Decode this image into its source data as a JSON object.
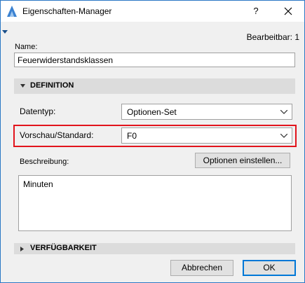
{
  "window": {
    "title": "Eigenschaften-Manager",
    "help_label": "?",
    "editable_text": "Bearbeitbar: 1"
  },
  "name": {
    "label": "Name:",
    "value": "Feuerwiderstandsklassen"
  },
  "definition": {
    "header": "DEFINITION",
    "datatype_label": "Datentyp:",
    "datatype_value": "Optionen-Set",
    "preview_label": "Vorschau/Standard:",
    "preview_value": "F0",
    "options_button": "Optionen einstellen...",
    "description_label": "Beschreibung:",
    "description_value": "Minuten"
  },
  "availability": {
    "header": "VERFÜGBARKEIT"
  },
  "footer": {
    "cancel_label": "Abbrechen",
    "ok_label": "OK"
  },
  "colors": {
    "highlight": "#e2141c",
    "window_border": "#2b78c5",
    "ok_focus": "#0078d7"
  }
}
